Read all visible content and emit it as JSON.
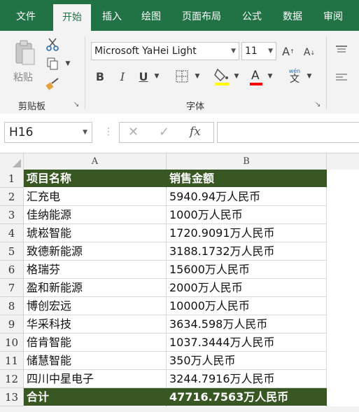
{
  "tabs": [
    "文件",
    "开始",
    "插入",
    "绘图",
    "页面布局",
    "公式",
    "数据",
    "审阅"
  ],
  "clipboard": {
    "paste_label": "粘贴",
    "group_label": "剪贴板"
  },
  "font": {
    "name": "Microsoft YaHei Light",
    "size": "11",
    "group_label": "字体",
    "bold": "B",
    "italic": "I",
    "underline": "U",
    "phonetic_top": "wén",
    "phonetic_bottom": "文"
  },
  "formula_bar": {
    "name_box": "H16",
    "cancel": "✕",
    "enter": "✓",
    "fx": "fx",
    "value": ""
  },
  "columns": [
    "A",
    "B"
  ],
  "rows": [
    {
      "num": "1",
      "a": "项目名称",
      "b": "销售金额"
    },
    {
      "num": "2",
      "a": "汇充电",
      "b": "5940.94万人民币"
    },
    {
      "num": "3",
      "a": "佳纳能源",
      "b": "1000万人民币"
    },
    {
      "num": "4",
      "a": "琥崧智能",
      "b": "1720.9091万人民币"
    },
    {
      "num": "5",
      "a": "致德新能源",
      "b": "3188.1732万人民币"
    },
    {
      "num": "6",
      "a": "格瑞芬",
      "b": "15600万人民币"
    },
    {
      "num": "7",
      "a": "盈和新能源",
      "b": "2000万人民币"
    },
    {
      "num": "8",
      "a": "博创宏远",
      "b": "10000万人民币"
    },
    {
      "num": "9",
      "a": "华采科技",
      "b": "3634.598万人民币"
    },
    {
      "num": "10",
      "a": "倍肯智能",
      "b": "1037.3444万人民币"
    },
    {
      "num": "11",
      "a": "储慧智能",
      "b": "350万人民币"
    },
    {
      "num": "12",
      "a": "四川中星电子",
      "b": "3244.7916万人民币"
    },
    {
      "num": "13",
      "a": "合计",
      "b": "47716.7563万人民币"
    }
  ],
  "colors": {
    "brand": "#217346",
    "header_fill": "#385723"
  }
}
